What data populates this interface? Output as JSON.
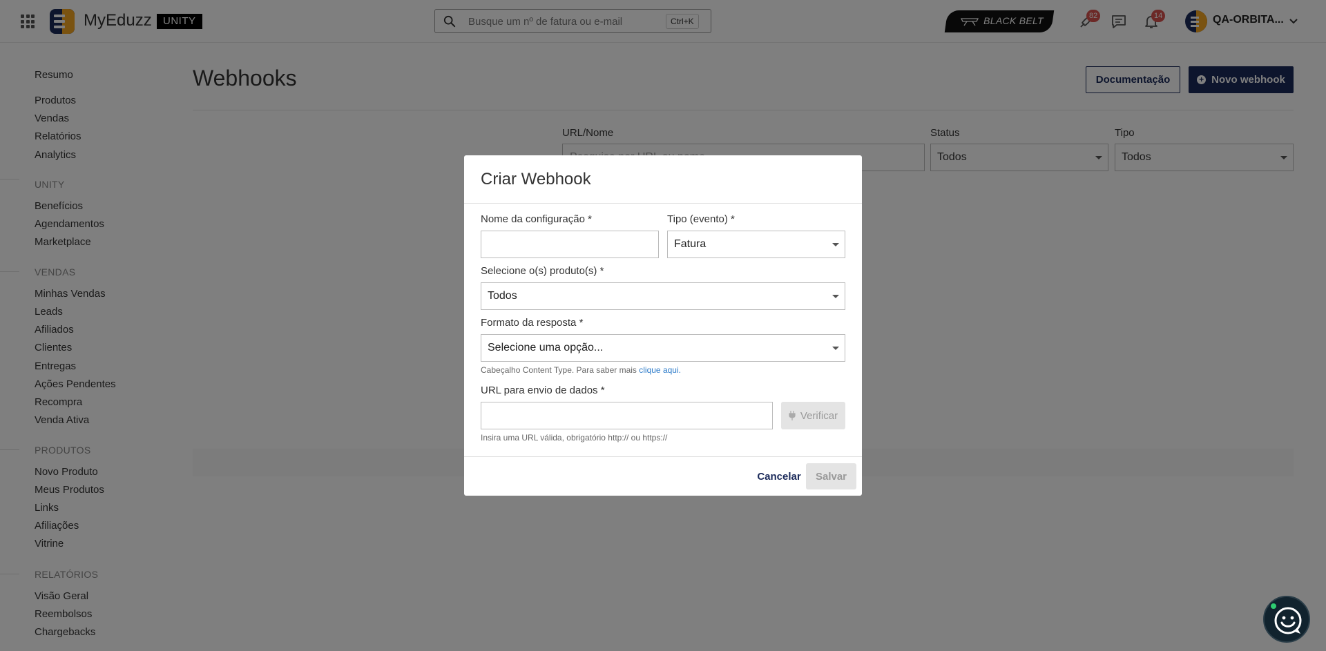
{
  "topbar": {
    "brand": "MyEduzz",
    "unity_badge": "UNITY",
    "search_placeholder": "Busque um nº de fatura ou e-mail",
    "search_shortcut": "Ctrl+K",
    "blackbelt_label": "BLACK BELT",
    "notifications": [
      {
        "icon": "rocket-icon",
        "count": "82"
      },
      {
        "icon": "chat-bubble-icon",
        "count": ""
      },
      {
        "icon": "bell-icon",
        "count": "14"
      }
    ],
    "user_name": "QA-ORBITA..."
  },
  "sidebar": {
    "top_items": [
      "Resumo",
      "Produtos",
      "Vendas",
      "Relatórios",
      "Analytics"
    ],
    "sections": [
      {
        "title": "UNITY",
        "items": [
          "Benefícios",
          "Agendamentos",
          "Marketplace"
        ]
      },
      {
        "title": "VENDAS",
        "items": [
          "Minhas Vendas",
          "Leads",
          "Afiliados",
          "Clientes",
          "Entregas",
          "Ações Pendentes",
          "Recompra",
          "Venda Ativa"
        ]
      },
      {
        "title": "PRODUTOS",
        "items": [
          "Novo Produto",
          "Meus Produtos",
          "Links",
          "Afiliações",
          "Vitrine"
        ]
      },
      {
        "title": "RELATÓRIOS",
        "items": [
          "Visão Geral",
          "Reembolsos",
          "Chargebacks"
        ]
      }
    ]
  },
  "main": {
    "title": "Webhooks",
    "doc_button": "Documentação",
    "new_button": "Novo webhook",
    "filters": {
      "url_label": "URL/Nome",
      "url_placeholder": "Pesquise por URL ou nome",
      "status_label": "Status",
      "status_value": "Todos",
      "type_label": "Tipo",
      "type_value": "Todos"
    }
  },
  "modal": {
    "title": "Criar Webhook",
    "name_label": "Nome da configuração *",
    "name_value": "",
    "event_label": "Tipo (evento) *",
    "event_value": "Fatura",
    "products_label": "Selecione o(s) produto(s) *",
    "products_value": "Todos",
    "format_label": "Formato da resposta *",
    "format_value": "Selecione uma opção...",
    "format_help": "Cabeçalho Content Type. Para saber mais ",
    "format_help_link": "clique aqui.",
    "url_label": "URL para envio de dados *",
    "url_value": "",
    "url_help": "Insira uma URL válida, obrigatório http:// ou https://",
    "verify_button": "Verificar",
    "cancel_button": "Cancelar",
    "save_button": "Salvar"
  },
  "colors": {
    "primary": "#1b2a5a",
    "accent": "#f5a623",
    "badge": "#d9534f",
    "link": "#2b7ac9",
    "overlay": "rgba(0,0,0,0.5)"
  }
}
